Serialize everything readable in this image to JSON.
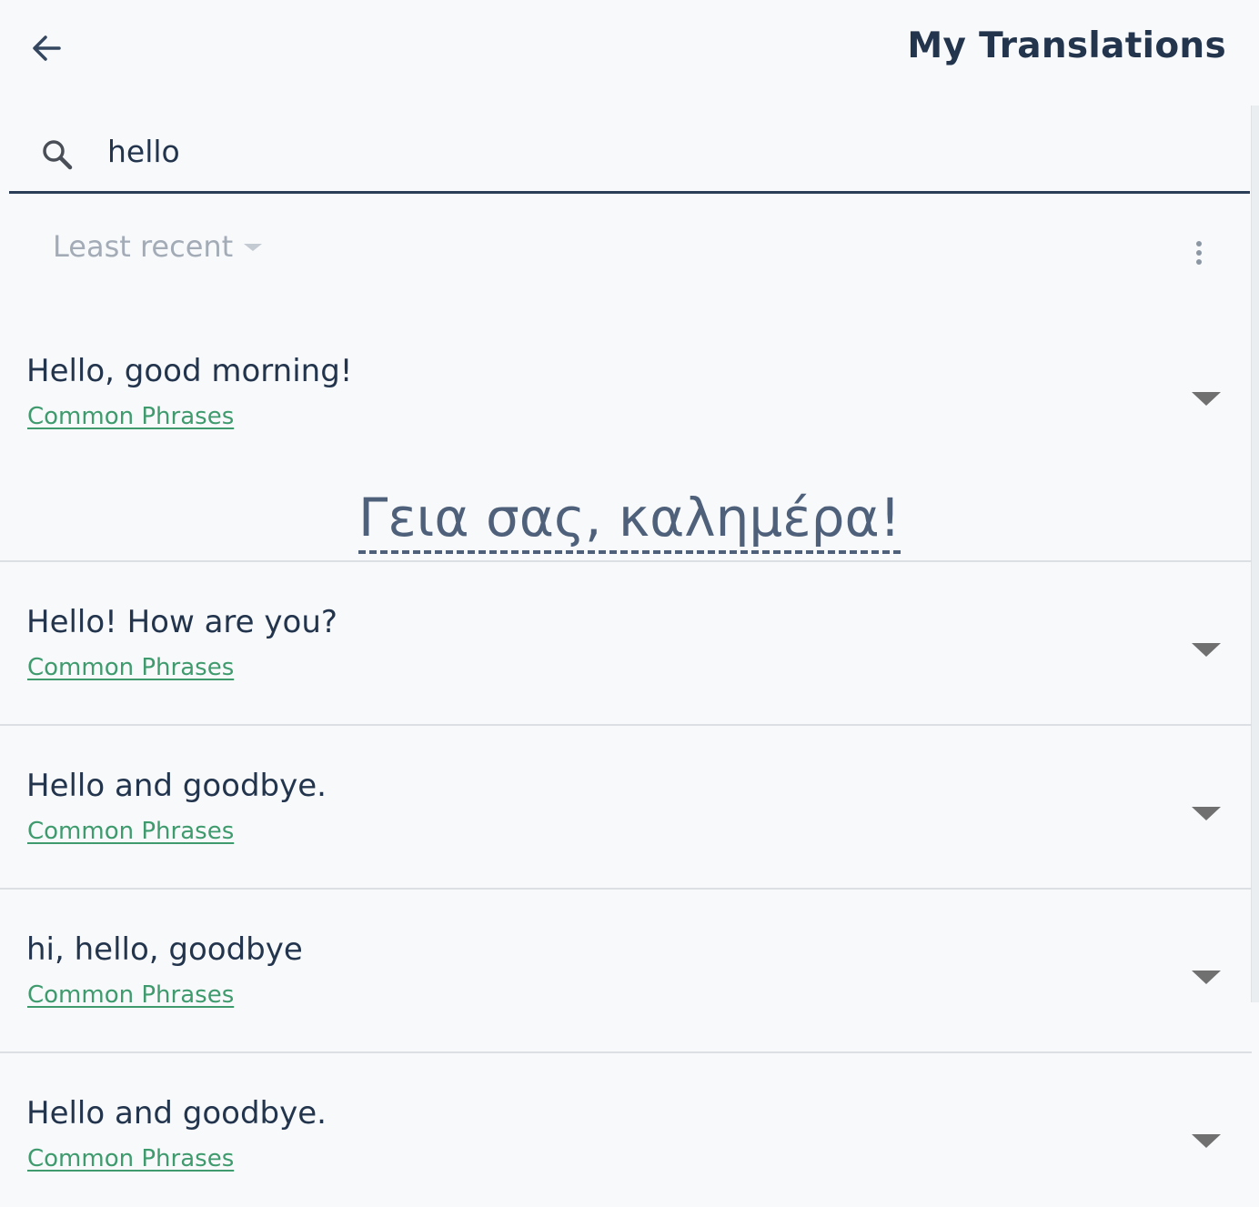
{
  "header": {
    "title": "My Translations",
    "back_icon": "arrow-left-icon"
  },
  "search": {
    "icon": "search-icon",
    "value": "hello",
    "placeholder": ""
  },
  "sort": {
    "selected": "Least recent",
    "more_icon": "more-vertical-icon"
  },
  "colors": {
    "primary_text": "#23344d",
    "category_link": "#3f9b6e",
    "muted": "#a3abb6",
    "background": "#f7f9fb"
  },
  "items": [
    {
      "text": "Hello, good morning!",
      "category": "Common Phrases",
      "expanded": true,
      "translation": "Γεια σας, καλημέρα!"
    },
    {
      "text": "Hello! How are you?",
      "category": "Common Phrases",
      "expanded": false
    },
    {
      "text": "Hello and goodbye.",
      "category": "Common Phrases",
      "expanded": false
    },
    {
      "text": "hi, hello, goodbye",
      "category": "Common Phrases",
      "expanded": false
    },
    {
      "text": "Hello and goodbye.",
      "category": "Common Phrases",
      "expanded": false
    }
  ]
}
